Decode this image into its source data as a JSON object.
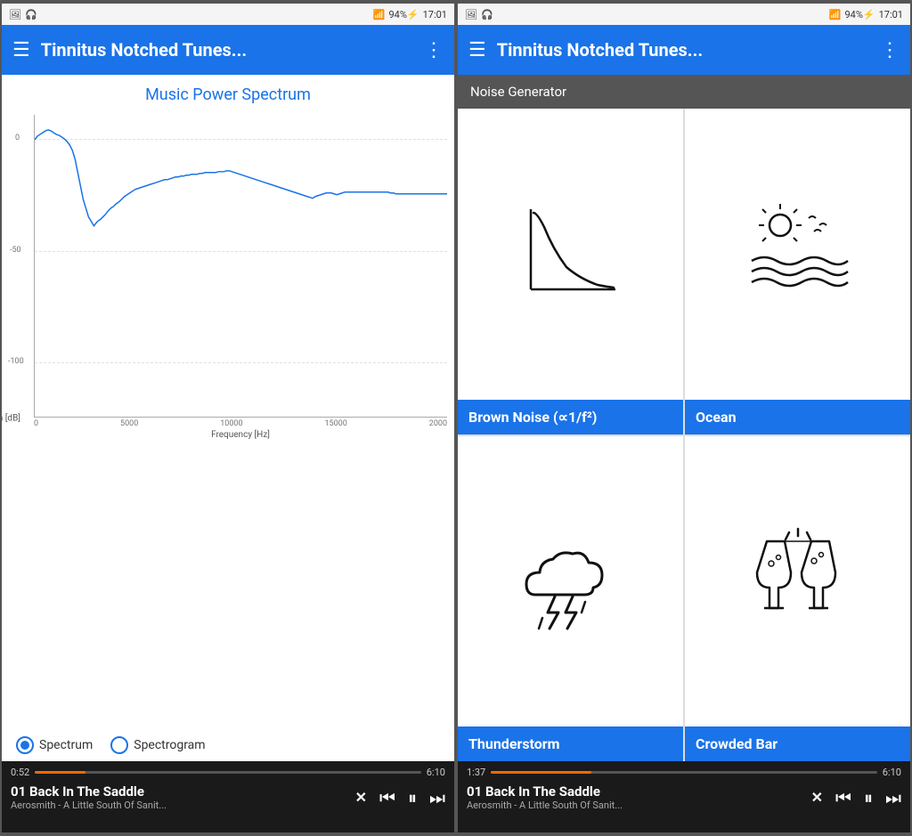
{
  "statusBar": {
    "leftIcons": [
      "🖼",
      "🎧"
    ],
    "wifi": "WiFi",
    "signal": "▲▲▲",
    "battery": "94%⚡",
    "time": "17:01"
  },
  "topBar": {
    "title": "Tinnitus Notched Tunes...",
    "hamburgerLabel": "☰",
    "moreLabel": "⋮"
  },
  "screen1": {
    "chartTitle": "Music Power Spectrum",
    "yAxisLabel": "Audio Spectrum [dB]",
    "xAxisLabel": "Frequency [Hz]",
    "xTicks": [
      "0",
      "5000",
      "10000",
      "15000",
      "2000"
    ],
    "yTicks": [
      {
        "value": "0",
        "pct": 8
      },
      {
        "value": "-50",
        "pct": 45
      },
      {
        "value": "-100",
        "pct": 83
      }
    ],
    "radioOptions": [
      "Spectrum",
      "Spectrogram"
    ],
    "selectedRadio": "Spectrum"
  },
  "screen2": {
    "noiseSectionLabel": "Noise Generator",
    "noiseItems": [
      {
        "id": "brown-noise",
        "label": "Brown Noise (∝1/f²)",
        "icon": "brown"
      },
      {
        "id": "ocean",
        "label": "Ocean",
        "icon": "ocean"
      },
      {
        "id": "thunderstorm",
        "label": "Thunderstorm",
        "icon": "thunderstorm"
      },
      {
        "id": "crowded-bar",
        "label": "Crowded Bar",
        "icon": "bar"
      }
    ]
  },
  "player1": {
    "timeStart": "0:52",
    "timeEnd": "6:10",
    "progressPct": 13,
    "title": "01 Back In The Saddle",
    "subtitle": "Aerosmith - A Little South Of Sanit..."
  },
  "player2": {
    "timeStart": "1:37",
    "timeEnd": "6:10",
    "progressPct": 26,
    "title": "01 Back In The Saddle",
    "subtitle": "Aerosmith - A Little South Of Sanit..."
  },
  "controls": {
    "shuffle": "✕",
    "prev": "⏮",
    "pause": "⏸",
    "next": "⏭"
  }
}
